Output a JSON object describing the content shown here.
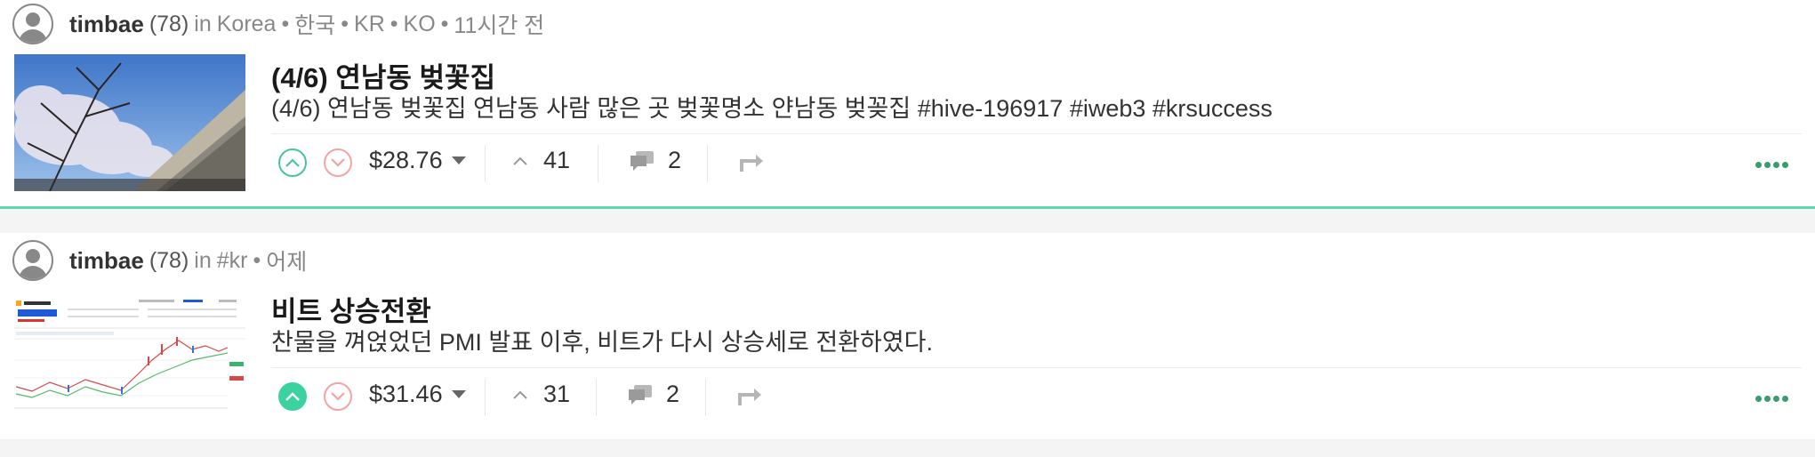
{
  "colors": {
    "accent": "#3cd2a0",
    "upvote": "#4bc39a",
    "downvote": "#f3a3a3",
    "more_dots": "#3a9b6e"
  },
  "posts": [
    {
      "author": "timbae",
      "reputation": "(78)",
      "community_prefix": "in",
      "community": "Korea",
      "tags": [
        "한국",
        "KR",
        "KO"
      ],
      "time": "11시간 전",
      "title": "(4/6) 연남동 벚꽃집",
      "description": "(4/6) 연남동 벚꽃집 연남동 사람 많은 곳 벚꽃명소 얀남동 벚꽂집 #hive-196917 #iweb3 #krsuccess",
      "thumbnail_icon": "cherry-blossom-photo",
      "upvoted": false,
      "payout": "$28.76",
      "votes": "41",
      "comments": "2"
    },
    {
      "author": "timbae",
      "reputation": "(78)",
      "community_prefix": "in",
      "community": "#kr",
      "tags": [],
      "time": "어제",
      "title": "비트 상승전환",
      "description": "찬물을 껴얹었던 PMI 발표 이후, 비트가 다시 상승세로 전환하였다.",
      "thumbnail_icon": "bitcoin-chart-screenshot",
      "upvoted": true,
      "payout": "$31.46",
      "votes": "31",
      "comments": "2"
    }
  ]
}
